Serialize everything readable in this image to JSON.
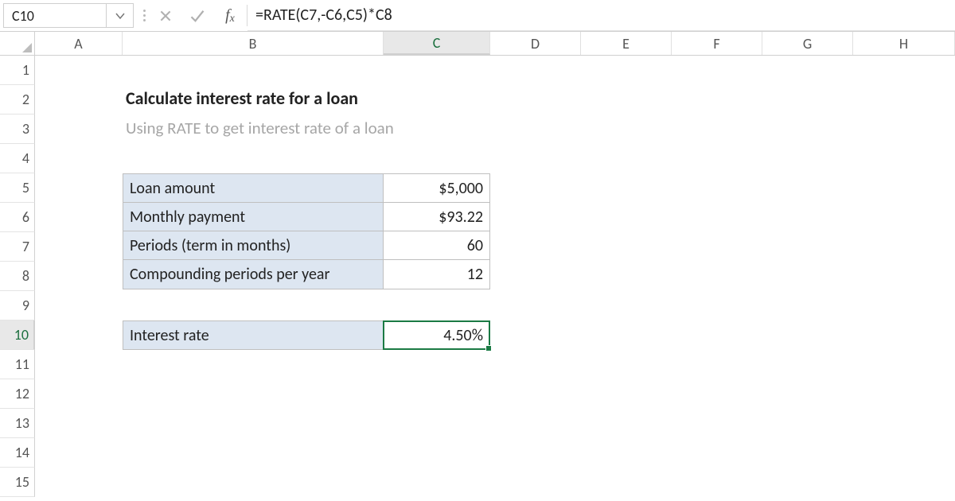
{
  "formula_bar": {
    "cell_ref": "C10",
    "formula": "=RATE(C7,-C6,C5)*C8",
    "fx_label_f": "f",
    "fx_label_x": "x"
  },
  "columns": [
    "A",
    "B",
    "C",
    "D",
    "E",
    "F",
    "G",
    "H"
  ],
  "selected_column": "C",
  "row_count": 15,
  "selected_row": 10,
  "sheet": {
    "title": "Calculate interest rate for a loan",
    "subtitle": "Using RATE to get interest rate of a loan",
    "table1": [
      {
        "label": "Loan amount",
        "value": "$5,000"
      },
      {
        "label": "Monthly payment",
        "value": "$93.22"
      },
      {
        "label": "Periods (term in months)",
        "value": "60"
      },
      {
        "label": "Compounding periods per year",
        "value": "12"
      }
    ],
    "result": {
      "label": "Interest rate",
      "value": "4.50%"
    }
  }
}
